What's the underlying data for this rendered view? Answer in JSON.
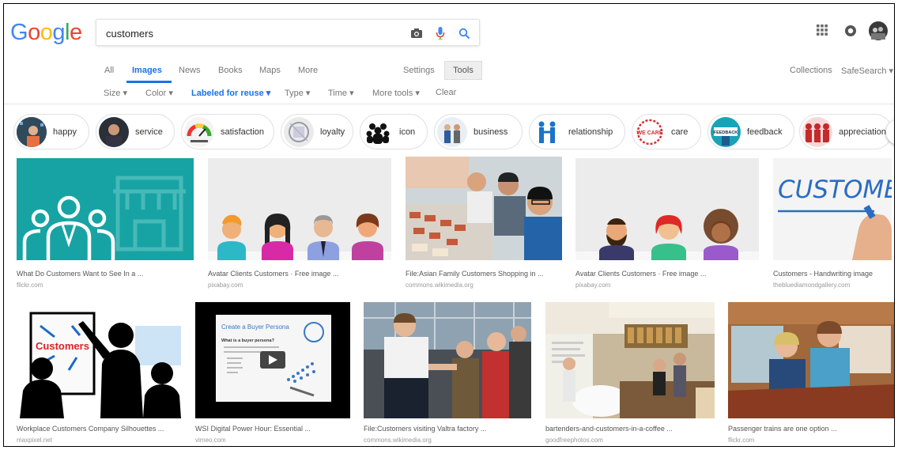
{
  "search": {
    "query": "customers"
  },
  "logo": {
    "letters": [
      "G",
      "o",
      "o",
      "g",
      "l",
      "e"
    ],
    "colors": [
      "#4285f4",
      "#ea4335",
      "#fbbc05",
      "#4285f4",
      "#34a853",
      "#ea4335"
    ]
  },
  "header_icons": [
    "camera-icon",
    "microphone-icon",
    "search-icon",
    "apps-grid-icon",
    "account-ring-icon",
    "avatar"
  ],
  "tabs": {
    "all": "All",
    "images": "Images",
    "news": "News",
    "books": "Books",
    "maps": "Maps",
    "more": "More",
    "settings": "Settings",
    "tools": "Tools",
    "collections": "Collections",
    "safesearch": "SafeSearch ▾"
  },
  "filters": {
    "size": "Size ▾",
    "color": "Color ▾",
    "license": "Labeled for reuse ▾",
    "type": "Type ▾",
    "time": "Time ▾",
    "more_tools": "More tools ▾",
    "clear": "Clear"
  },
  "chips": [
    {
      "label": "happy"
    },
    {
      "label": "service"
    },
    {
      "label": "satisfaction"
    },
    {
      "label": "loyalty"
    },
    {
      "label": "icon"
    },
    {
      "label": "business"
    },
    {
      "label": "relationship"
    },
    {
      "label": "care"
    },
    {
      "label": "feedback"
    },
    {
      "label": "appreciation"
    }
  ],
  "results": [
    {
      "title": "What Do Customers Want to See In a ...",
      "source": "flickr.com"
    },
    {
      "title": "Avatar Clients Customers · Free image ...",
      "source": "pixabay.com"
    },
    {
      "title": "File:Asian Family Customers Shopping in ...",
      "source": "commons.wikimedia.org"
    },
    {
      "title": "Avatar Clients Customers · Free image ...",
      "source": "pixabay.com"
    },
    {
      "title": "Customers - Handwriting image",
      "source": "thebluediamondgallery.com"
    },
    {
      "title": "Workplace Customers Company Silhouettes ...",
      "source": "maxpixel.net"
    },
    {
      "title": "WSI Digital Power Hour: Essential ...",
      "source": "vimeo.com"
    },
    {
      "title": "File:Customers visiting Valtra factory ...",
      "source": "commons.wikimedia.org"
    },
    {
      "title": "bartenders-and-customers-in-a-coffee ...",
      "source": "goodfreephotos.com"
    },
    {
      "title": "Passenger trains are one option ...",
      "source": "flickr.com"
    }
  ],
  "image_text": {
    "handwriting": "CUSTOMERS",
    "whiteboard": "Customers",
    "slide_title": "Create a Buyer Persona",
    "slide_bullet": "What is a buyer persona?",
    "badge_care": "WE CARE",
    "badge_feedback": "FEEDBACK"
  }
}
